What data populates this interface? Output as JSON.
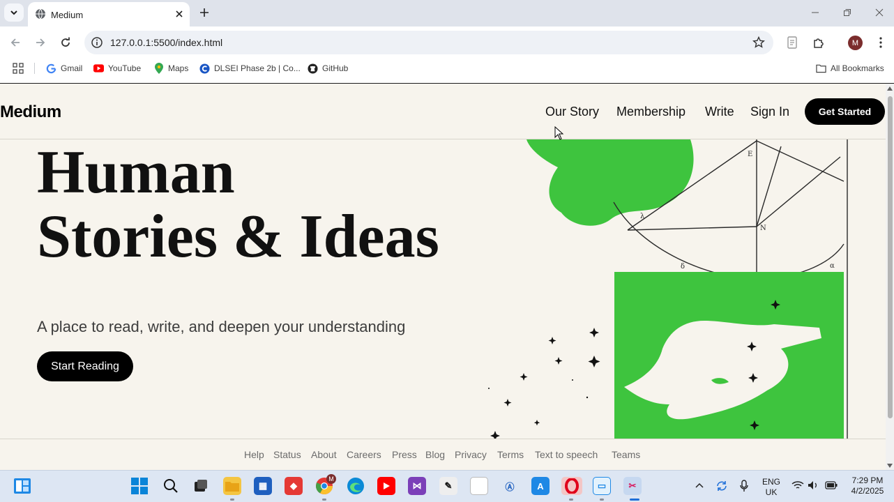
{
  "browser": {
    "tab": {
      "title": "Medium"
    },
    "url": "127.0.0.1:5500/index.html",
    "profile_initial": "M",
    "bookmarks": [
      {
        "label": "Gmail",
        "icon": "gmail-icon"
      },
      {
        "label": "YouTube",
        "icon": "youtube-icon"
      },
      {
        "label": "Maps",
        "icon": "maps-icon"
      },
      {
        "label": "DLSEI Phase 2b | Co...",
        "icon": "dlsei-icon"
      },
      {
        "label": "GitHub",
        "icon": "github-icon"
      }
    ],
    "all_bookmarks": "All Bookmarks"
  },
  "page": {
    "header": {
      "logo": "Medium",
      "nav": [
        "Our Story",
        "Membership",
        "Write",
        "Sign In"
      ],
      "cta": "Get Started"
    },
    "hero": {
      "title_line1": "Human",
      "title_line2": "Stories & Ideas",
      "subtitle": "A place to read, write, and deepen your understanding",
      "button": "Start Reading"
    },
    "footer": {
      "links": [
        "Help",
        "Status",
        "About",
        "Careers",
        "Press",
        "Blog",
        "Privacy",
        "Terms",
        "Text to speech",
        "Teams"
      ]
    },
    "colors": {
      "background": "#f7f4ed",
      "accent_green": "#3ec43e",
      "button_black": "#000000"
    }
  },
  "taskbar": {
    "language": "ENG",
    "region": "UK",
    "time": "7:29 PM",
    "date": "4/2/2025",
    "chrome_badge": "M"
  }
}
